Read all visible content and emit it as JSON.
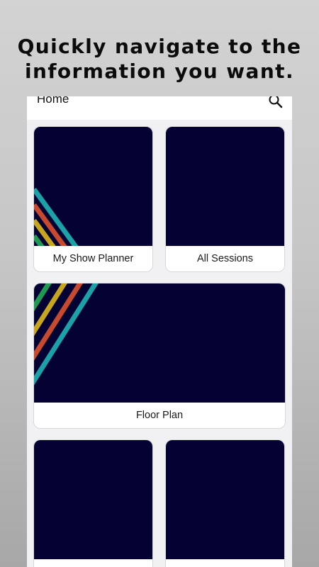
{
  "headline": {
    "line1": "Quickly navigate to the",
    "line2": "information you want."
  },
  "topbar": {
    "title": "Home",
    "search_icon": "search-icon"
  },
  "tiles": [
    {
      "label": "My Show Planner"
    },
    {
      "label": "All Sessions"
    },
    {
      "label": "Floor Plan"
    },
    {
      "label": ""
    },
    {
      "label": ""
    }
  ],
  "colors": {
    "tile_background": "#040233",
    "stripe_green": "#1f9a52",
    "stripe_yellow": "#c7a51c",
    "stripe_red": "#c74a2e",
    "stripe_teal": "#1aa2a8"
  }
}
